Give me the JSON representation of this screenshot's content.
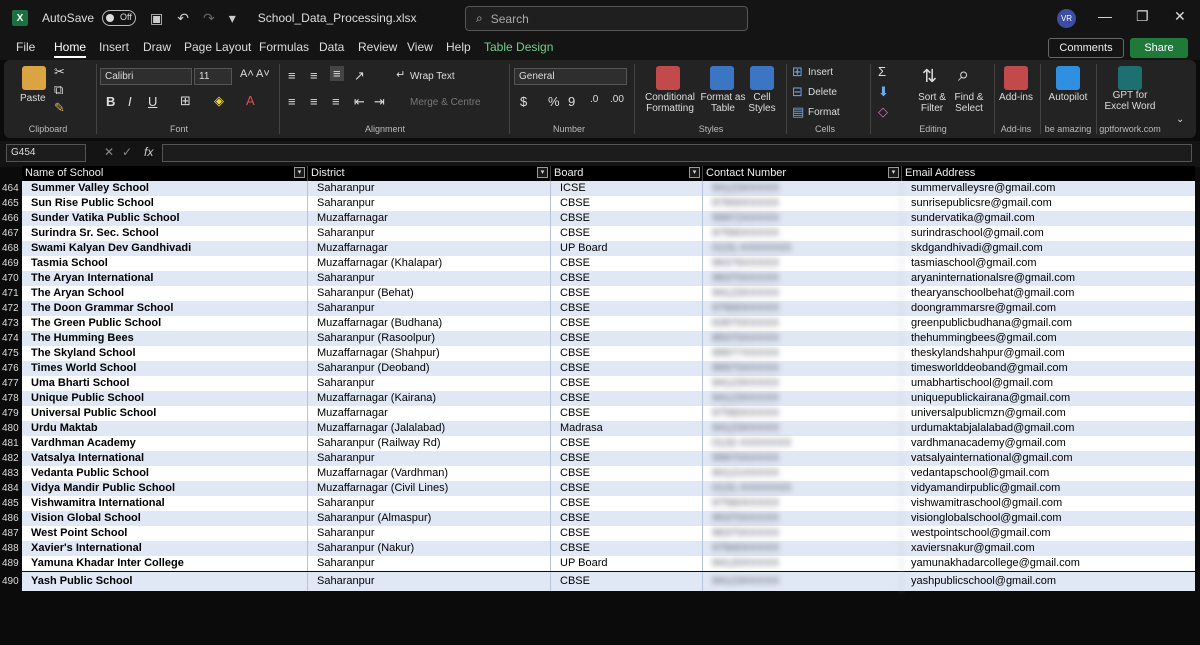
{
  "app": {
    "autosave_label": "AutoSave",
    "autosave_state": "Off",
    "file_name": "School_Data_Processing.xlsx",
    "search_placeholder": "Search",
    "user_initials": "VR"
  },
  "menu": {
    "tabs": [
      "File",
      "Home",
      "Insert",
      "Draw",
      "Page Layout",
      "Formulas",
      "Data",
      "Review",
      "View",
      "Help",
      "Table Design"
    ],
    "active": "Home",
    "comments": "Comments",
    "share": "Share"
  },
  "ribbon": {
    "clipboard": {
      "paste": "Paste",
      "group": "Clipboard"
    },
    "font": {
      "name": "Calibri",
      "size": "11",
      "group": "Font",
      "bold": "B",
      "italic": "I",
      "underline": "U"
    },
    "alignment": {
      "wrap": "Wrap Text",
      "merge": "Merge & Centre",
      "group": "Alignment"
    },
    "number": {
      "format": "General",
      "group": "Number"
    },
    "styles": {
      "conditional": "Conditional Formatting",
      "format_table": "Format as Table",
      "cell_styles": "Cell Styles",
      "group": "Styles"
    },
    "cells": {
      "insert": "Insert",
      "delete": "Delete",
      "format": "Format",
      "group": "Cells"
    },
    "editing": {
      "sort": "Sort & Filter",
      "find": "Find & Select",
      "group": "Editing"
    },
    "addins": {
      "addins": "Add-ins",
      "group": "Add-ins"
    },
    "autopilot": {
      "label": "Autopilot",
      "sub": "be amazing"
    },
    "gpt": {
      "label": "GPT for Excel Word",
      "sub": "gptforwork.com"
    },
    "accent": "#1f7a3a"
  },
  "formula": {
    "name_box": "G454",
    "fx": "fx",
    "value": ""
  },
  "table": {
    "headers": [
      "Name of School",
      "District",
      "Board",
      "Contact Number",
      "Email Address"
    ],
    "rows": [
      {
        "n": "464",
        "school": "Summer Valley School",
        "district": "Saharanpur",
        "board": "ICSE",
        "contact": "94123XXXXX",
        "email": "summervalleysre@gmail.com"
      },
      {
        "n": "465",
        "school": "Sun Rise Public School",
        "district": "Saharanpur",
        "board": "CBSE",
        "contact": "97600XXXXX",
        "email": "sunrisepublicsre@gmail.com"
      },
      {
        "n": "466",
        "school": "Sunder Vatika Public School",
        "district": "Muzaffarnagar",
        "board": "CBSE",
        "contact": "99972XXXXX",
        "email": "sundervatika@gmail.com"
      },
      {
        "n": "467",
        "school": "Surindra Sr. Sec. School",
        "district": "Saharanpur",
        "board": "CBSE",
        "contact": "97560XXXXX",
        "email": "surindraschool@gmail.com"
      },
      {
        "n": "468",
        "school": "Swami Kalyan Dev Gandhivadi",
        "district": "Muzaffarnagar",
        "board": "UP Board",
        "contact": "0131-XXXXXXX",
        "email": "skdgandhivadi@gmail.com"
      },
      {
        "n": "469",
        "school": "Tasmia School",
        "district": "Muzaffarnagar (Khalapar)",
        "board": "CBSE",
        "contact": "96376XXXXX",
        "email": "tasmiaschool@gmail.com"
      },
      {
        "n": "470",
        "school": "The Aryan International",
        "district": "Saharanpur",
        "board": "CBSE",
        "contact": "98370XXXXX",
        "email": "aryaninternationalsre@gmail.com"
      },
      {
        "n": "471",
        "school": "The Aryan School",
        "district": "Saharanpur (Behat)",
        "board": "CBSE",
        "contact": "94123XXXXX",
        "email": "thearyanschoolbehat@gmail.com"
      },
      {
        "n": "472",
        "school": "The Doon Grammar School",
        "district": "Saharanpur",
        "board": "CBSE",
        "contact": "97600XXXXX",
        "email": "doongrammarsre@gmail.com"
      },
      {
        "n": "473",
        "school": "The Green Public School",
        "district": "Muzaffarnagar (Budhana)",
        "board": "CBSE",
        "contact": "63970XXXXX",
        "email": "greenpublicbudhana@gmail.com"
      },
      {
        "n": "474",
        "school": "The Humming Bees",
        "district": "Saharanpur (Rasoolpur)",
        "board": "CBSE",
        "contact": "89370XXXXX",
        "email": "thehummingbees@gmail.com"
      },
      {
        "n": "475",
        "school": "The Skyland School",
        "district": "Muzaffarnagar (Shahpur)",
        "board": "CBSE",
        "contact": "99977XXXXX",
        "email": "theskylandshahpur@gmail.com"
      },
      {
        "n": "476",
        "school": "Times World School",
        "district": "Saharanpur (Deoband)",
        "board": "CBSE",
        "contact": "96970XXXXX",
        "email": "timesworlddeoband@gmail.com"
      },
      {
        "n": "477",
        "school": "Uma Bharti School",
        "district": "Saharanpur",
        "board": "CBSE",
        "contact": "94123XXXXX",
        "email": "umabhartischool@gmail.com"
      },
      {
        "n": "478",
        "school": "Unique Public School",
        "district": "Muzaffarnagar (Kairana)",
        "board": "CBSE",
        "contact": "94123XXXXX",
        "email": "uniquepublickairana@gmail.com"
      },
      {
        "n": "479",
        "school": "Universal Public School",
        "district": "Muzaffarnagar",
        "board": "CBSE",
        "contact": "97560XXXXX",
        "email": "universalpublicmzn@gmail.com"
      },
      {
        "n": "480",
        "school": "Urdu Maktab",
        "district": "Muzaffarnagar (Jalalabad)",
        "board": "Madrasa",
        "contact": "94123XXXXX",
        "email": "urdumaktabjalalabad@gmail.com"
      },
      {
        "n": "481",
        "school": "Vardhman Academy",
        "district": "Saharanpur (Railway Rd)",
        "board": "CBSE",
        "contact": "0132-XXXXXXX",
        "email": "vardhmanacademy@gmail.com"
      },
      {
        "n": "482",
        "school": "Vatsalya International",
        "district": "Saharanpur",
        "board": "CBSE",
        "contact": "99970XXXXX",
        "email": "vatsalyainternational@gmail.com"
      },
      {
        "n": "483",
        "school": "Vedanta Public School",
        "district": "Muzaffarnagar (Vardhman)",
        "board": "CBSE",
        "contact": "90121XXXXX",
        "email": "vedantapschool@gmail.com"
      },
      {
        "n": "484",
        "school": "Vidya Mandir Public School",
        "district": "Muzaffarnagar (Civil Lines)",
        "board": "CBSE",
        "contact": "0131-XXXXXXX",
        "email": "vidyamandirpublic@gmail.com"
      },
      {
        "n": "485",
        "school": "Vishwamitra International",
        "district": "Saharanpur",
        "board": "CBSE",
        "contact": "97560XXXXX",
        "email": "vishwamitraschool@gmail.com"
      },
      {
        "n": "486",
        "school": "Vision Global School",
        "district": "Saharanpur (Almaspur)",
        "board": "CBSE",
        "contact": "95370XXXXX",
        "email": "visionglobalschool@gmail.com"
      },
      {
        "n": "487",
        "school": "West Point School",
        "district": "Saharanpur",
        "board": "CBSE",
        "contact": "96370XXXXX",
        "email": "westpointschool@gmail.com"
      },
      {
        "n": "488",
        "school": "Xavier's International",
        "district": "Saharanpur (Nakur)",
        "board": "CBSE",
        "contact": "97600XXXXX",
        "email": "xaviersnakur@gmail.com"
      },
      {
        "n": "489",
        "school": "Yamuna Khadar Inter College",
        "district": "Saharanpur",
        "board": "UP Board",
        "contact": "94120XXXXX",
        "email": "yamunakhadarcollege@gmail.com"
      },
      {
        "n": "490",
        "school": "Yash Public School",
        "district": "Saharanpur",
        "board": "CBSE",
        "contact": "94123XXXXX",
        "email": "yashpublicschool@gmail.com"
      }
    ]
  },
  "colors": {
    "row_a": "#e1e8f5",
    "row_b": "#ffffff",
    "header_bg": "#000000"
  }
}
